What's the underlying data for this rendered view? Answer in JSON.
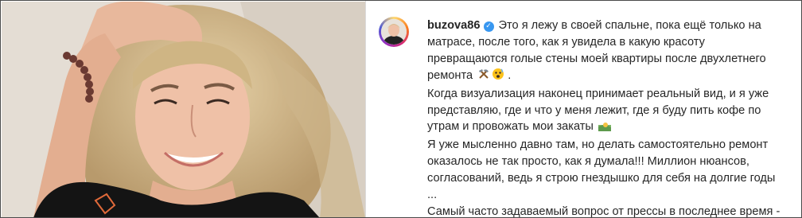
{
  "post": {
    "username": "buzova86",
    "verified_icon": "verified-badge-icon",
    "accent_color": "#3897f0",
    "caption_lines": [
      "Это я лежу в своей спальне, пока ещё только на",
      "матрасе, после того, как я увидела в какую красоту",
      "превращаются голые стены моей квартиры после двухлетнего",
      "ремонта",
      "Когда визуализация наконец принимает реальный вид, и я уже",
      "представляю, где и что у меня лежит, где я буду пить кофе по",
      "утрам и провожать мои закаты",
      "Я уже мысленно давно там, но делать самостоятельно ремонт",
      "оказалось не так просто, как я думала!!! Миллион нюансов,",
      "согласований, ведь я строю гнездышко для себя на долгие годы",
      "...",
      "Самый часто задаваемый вопрос от прессы в последнее время -"
    ],
    "line4_suffix": " .",
    "emoji_icons": [
      "hammer-pick-emoji-icon",
      "shocked-face-emoji-icon",
      "sunset-emoji-icon"
    ]
  }
}
